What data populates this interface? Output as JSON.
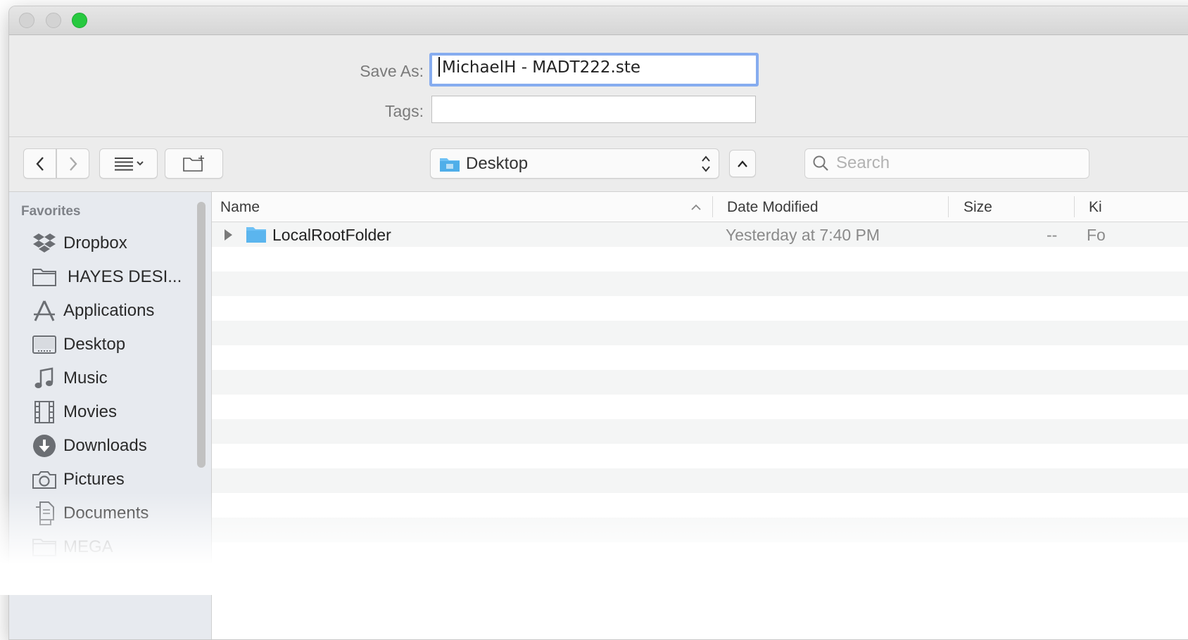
{
  "form": {
    "save_as_label": "Save As:",
    "save_as_value": "MichaelH - MADT222.ste",
    "tags_label": "Tags:",
    "tags_value": ""
  },
  "toolbar": {
    "location_label": "Desktop",
    "search_placeholder": "Search"
  },
  "sidebar": {
    "heading": "Favorites",
    "items": [
      {
        "label": "Dropbox",
        "icon": "dropbox-icon"
      },
      {
        "label": "HAYES DESI...",
        "icon": "folder-icon"
      },
      {
        "label": "Applications",
        "icon": "applications-icon"
      },
      {
        "label": "Desktop",
        "icon": "desktop-icon"
      },
      {
        "label": "Music",
        "icon": "music-icon"
      },
      {
        "label": "Movies",
        "icon": "movies-icon"
      },
      {
        "label": "Downloads",
        "icon": "downloads-icon"
      },
      {
        "label": "Pictures",
        "icon": "camera-icon"
      },
      {
        "label": "Documents",
        "icon": "documents-icon"
      },
      {
        "label": "MEGA",
        "icon": "folder-icon"
      }
    ]
  },
  "columns": {
    "name": "Name",
    "date_modified": "Date Modified",
    "size": "Size",
    "kind": "Ki"
  },
  "files": [
    {
      "name": "LocalRootFolder",
      "date_modified": "Yesterday at 7:40 PM",
      "size": "--",
      "kind": "Fo"
    }
  ],
  "colors": {
    "focus_ring": "#86acef",
    "zoom_button": "#27c93f",
    "folder": "#6ec1f5",
    "sidebar_bg": "#e7eaef"
  }
}
